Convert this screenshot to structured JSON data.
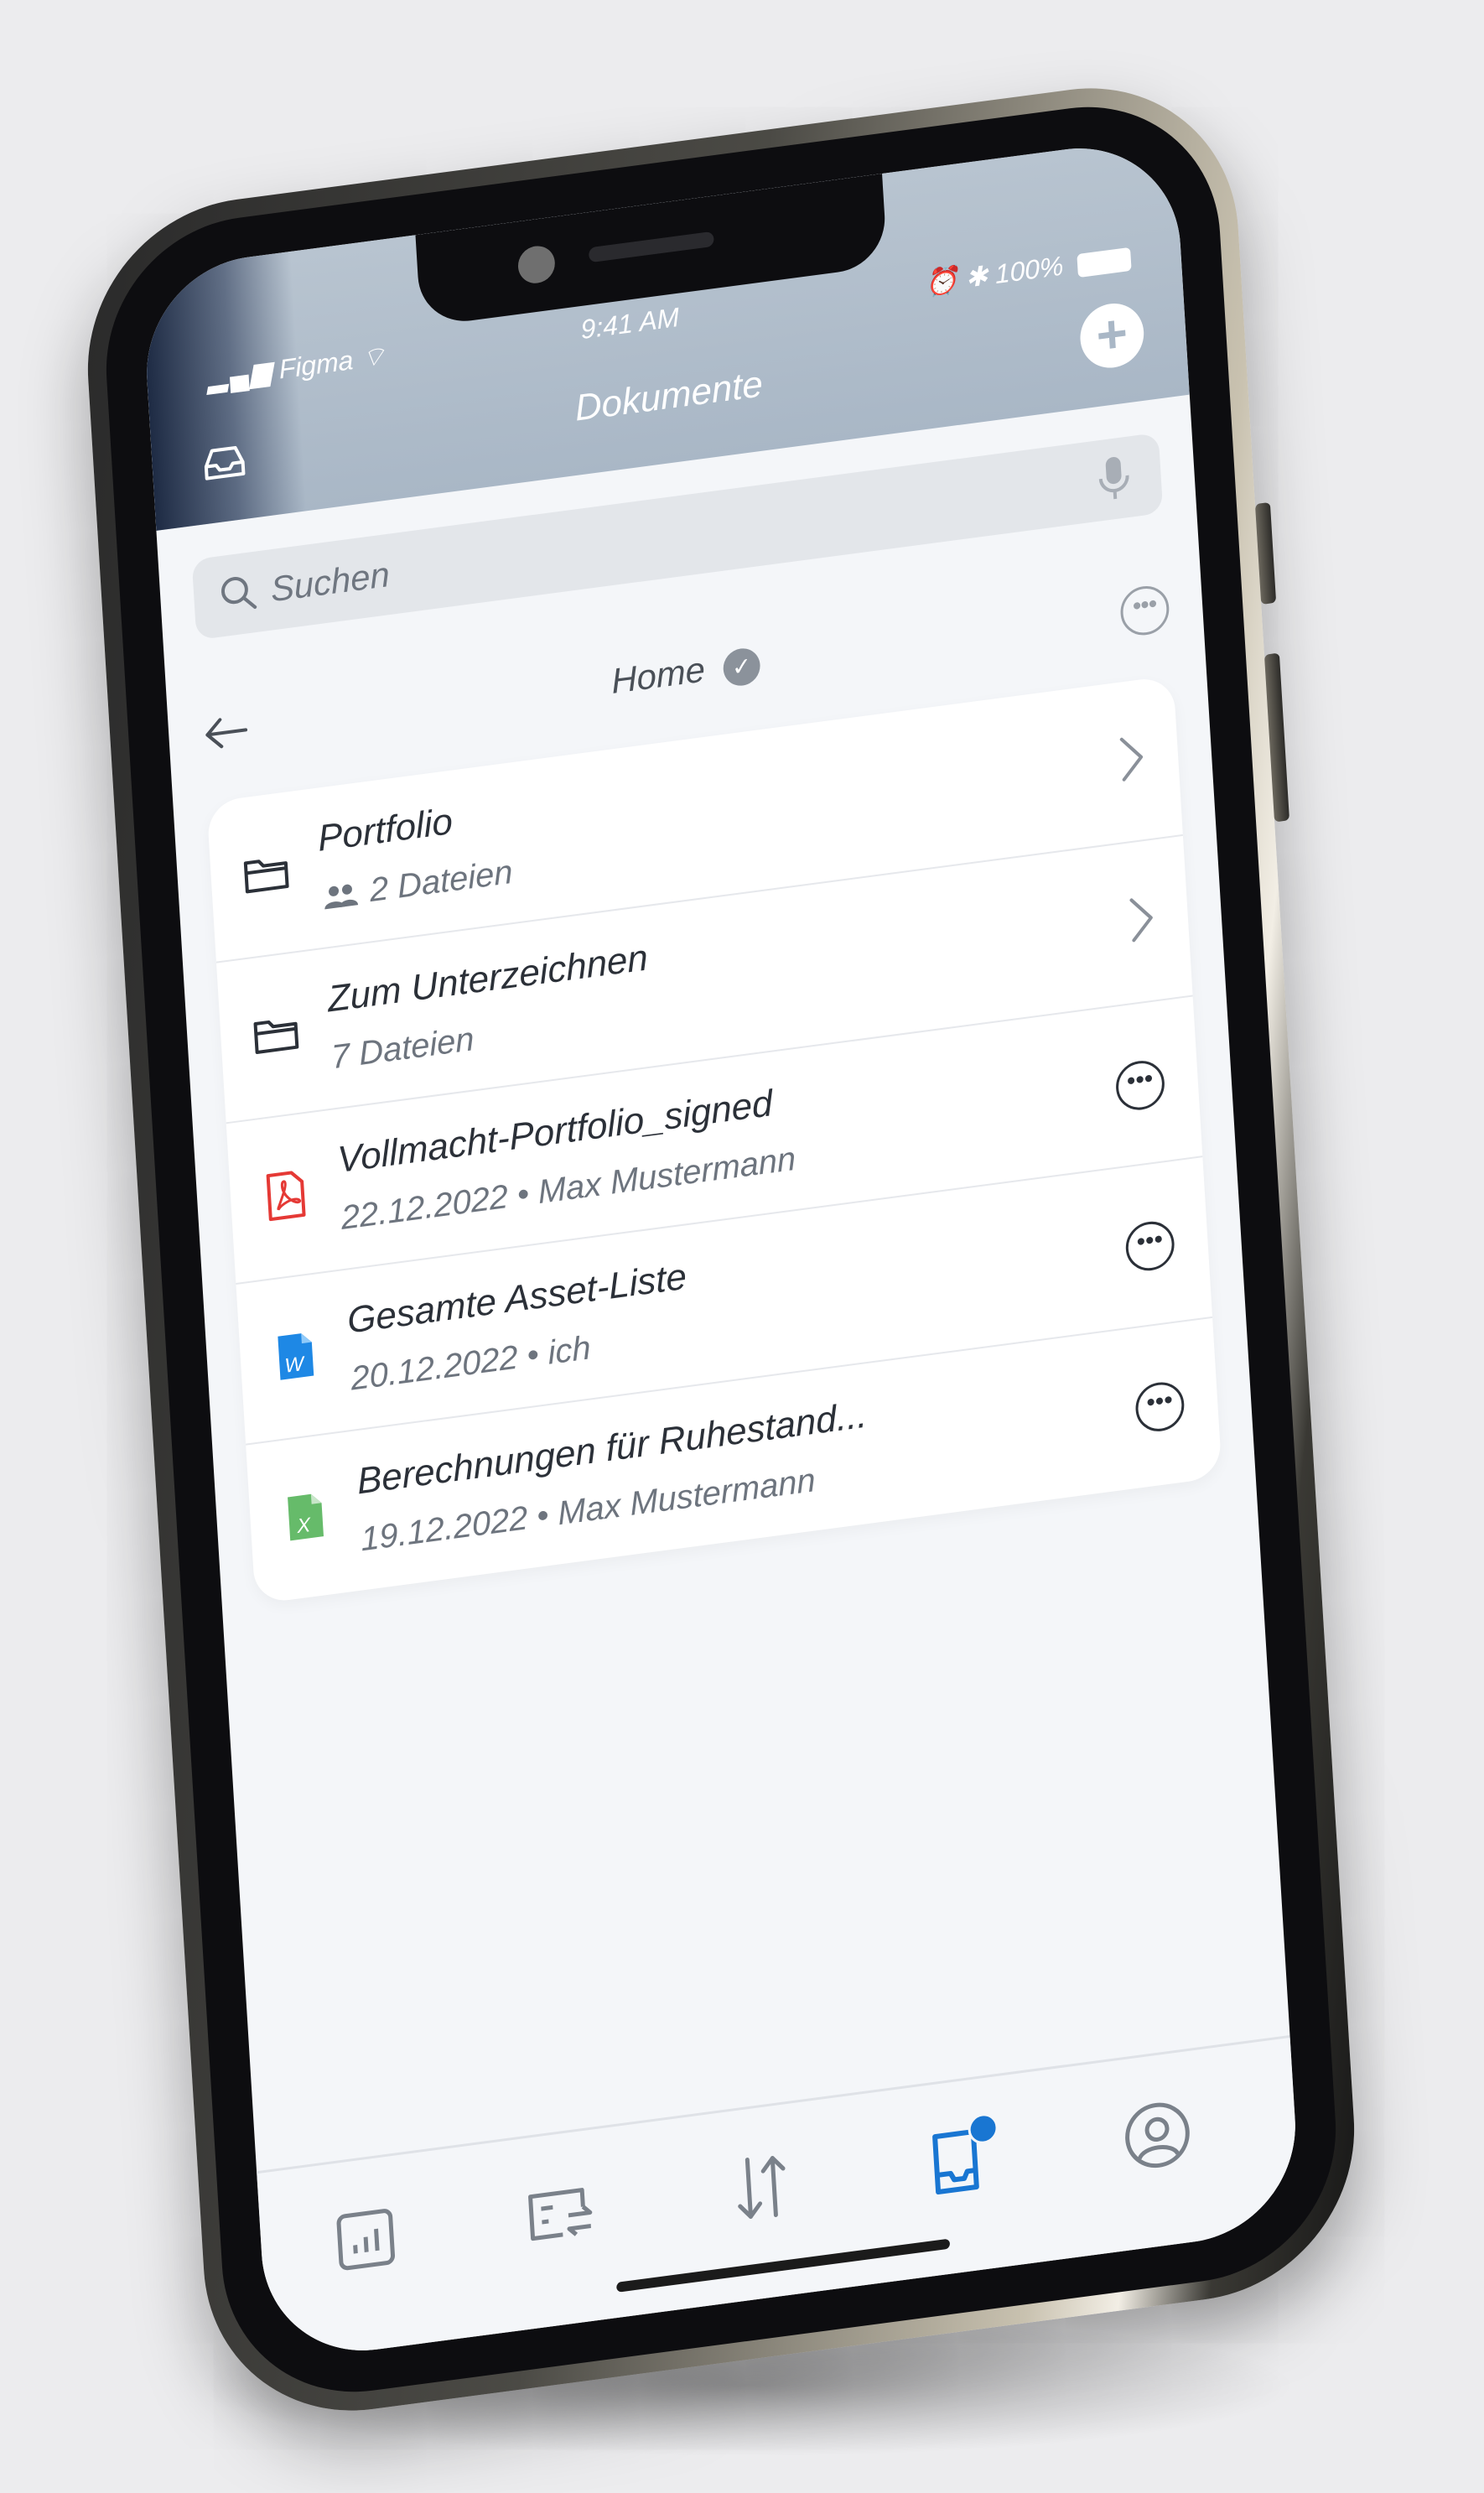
{
  "status_bar": {
    "carrier": "Figma",
    "time": "9:41 AM",
    "battery": "100%"
  },
  "header": {
    "title": "Dokumente"
  },
  "search": {
    "placeholder": "Suchen"
  },
  "breadcrumb": {
    "current": "Home"
  },
  "items": [
    {
      "type": "folder",
      "title": "Portfolio",
      "subtitle": "2 Dateien",
      "shared": true,
      "icon": "folder-icon"
    },
    {
      "type": "folder",
      "title": "Zum Unterzeichnen",
      "subtitle": "7 Dateien",
      "shared": false,
      "icon": "folder-icon"
    },
    {
      "type": "file",
      "title": "Vollmacht-Portfolio_signed",
      "subtitle": "22.12.2022 • Max Mustermann",
      "icon": "pdf-file-icon",
      "color": "#e53935"
    },
    {
      "type": "file",
      "title": "Gesamte Asset-Liste",
      "subtitle": "20.12.2022 • ich",
      "icon": "word-file-icon",
      "color": "#1e88e5"
    },
    {
      "type": "file",
      "title": "Berechnungen für Ruhestand...",
      "subtitle": "19.12.2022 • Max Mustermann",
      "icon": "excel-file-icon",
      "color": "#43a047"
    }
  ],
  "tabbar": {
    "tabs": [
      {
        "name": "overview",
        "icon": "chart-icon",
        "active": false
      },
      {
        "name": "transfers",
        "icon": "transfer-icon",
        "active": false
      },
      {
        "name": "sort",
        "icon": "sort-arrows-icon",
        "active": false
      },
      {
        "name": "documents",
        "icon": "inbox-icon",
        "active": true,
        "badge": true
      },
      {
        "name": "profile",
        "icon": "profile-icon",
        "active": false
      }
    ]
  },
  "colors": {
    "accent": "#1976d2",
    "header_bg": "#a9b7c6",
    "pdf": "#e53935",
    "word": "#1e88e5",
    "excel": "#43a047"
  }
}
